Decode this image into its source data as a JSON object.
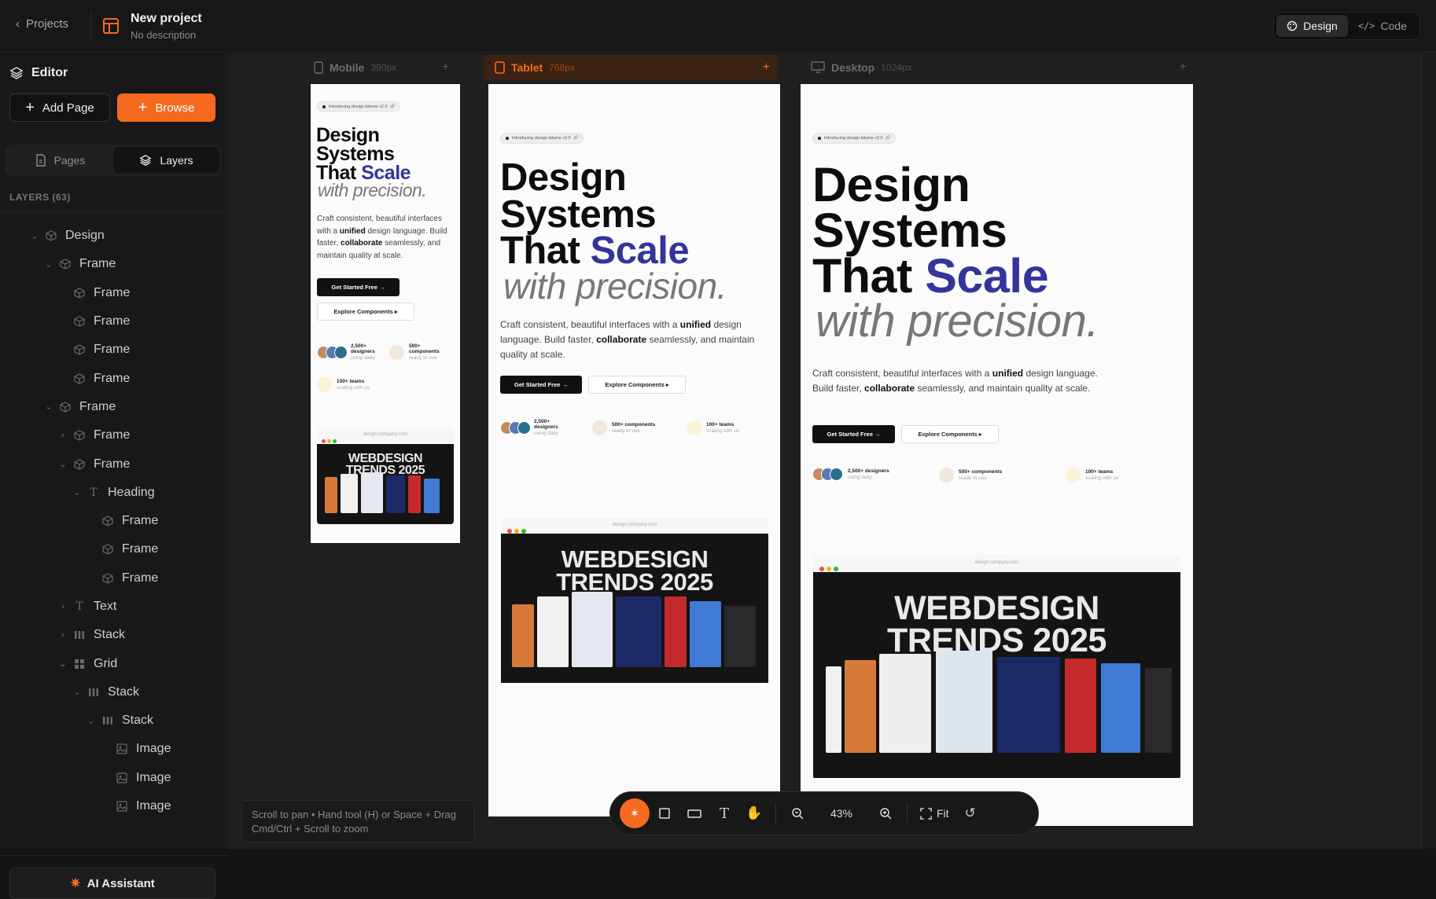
{
  "header": {
    "back_label": "Projects",
    "project_title": "New project",
    "project_desc": "No description",
    "modes": [
      "Design",
      "Code"
    ]
  },
  "sidebar": {
    "title": "Editor",
    "add_page": "Add Page",
    "browse": "Browse",
    "tabs": [
      "Pages",
      "Layers"
    ],
    "layers_count": "LAYERS (63)",
    "ai_label": "AI Assistant",
    "layers": [
      {
        "label": "Design",
        "depth": 0,
        "chev": "open",
        "icon": "component-icon"
      },
      {
        "label": "Frame",
        "depth": 1,
        "chev": "open",
        "icon": "component-icon"
      },
      {
        "label": "Frame",
        "depth": 2,
        "chev": "",
        "icon": "component-icon"
      },
      {
        "label": "Frame",
        "depth": 2,
        "chev": "",
        "icon": "component-icon"
      },
      {
        "label": "Frame",
        "depth": 2,
        "chev": "",
        "icon": "component-icon"
      },
      {
        "label": "Frame",
        "depth": 2,
        "chev": "",
        "icon": "component-icon"
      },
      {
        "label": "Frame",
        "depth": 1,
        "chev": "open",
        "icon": "component-icon"
      },
      {
        "label": "Frame",
        "depth": 2,
        "chev": "closed",
        "icon": "component-icon"
      },
      {
        "label": "Frame",
        "depth": 2,
        "chev": "open",
        "icon": "component-icon"
      },
      {
        "label": "Heading",
        "depth": 3,
        "chev": "open",
        "icon": "text-icon"
      },
      {
        "label": "Frame",
        "depth": 4,
        "chev": "",
        "icon": "component-icon"
      },
      {
        "label": "Frame",
        "depth": 4,
        "chev": "",
        "icon": "component-icon"
      },
      {
        "label": "Frame",
        "depth": 4,
        "chev": "",
        "icon": "component-icon"
      },
      {
        "label": "Text",
        "depth": 2,
        "chev": "closed",
        "icon": "text-icon"
      },
      {
        "label": "Stack",
        "depth": 2,
        "chev": "closed",
        "icon": "stack-icon"
      },
      {
        "label": "Grid",
        "depth": 2,
        "chev": "open",
        "icon": "grid-icon"
      },
      {
        "label": "Stack",
        "depth": 3,
        "chev": "open",
        "icon": "stack-icon"
      },
      {
        "label": "Stack",
        "depth": 4,
        "chev": "open",
        "icon": "stack-icon"
      },
      {
        "label": "Image",
        "depth": 5,
        "chev": "",
        "icon": "image-icon"
      },
      {
        "label": "Image",
        "depth": 5,
        "chev": "",
        "icon": "image-icon"
      },
      {
        "label": "Image",
        "depth": 5,
        "chev": "",
        "icon": "image-icon"
      }
    ]
  },
  "devices": {
    "mobile": {
      "name": "Mobile",
      "px": "390px"
    },
    "tablet": {
      "name": "Tablet",
      "px": "768px"
    },
    "desktop": {
      "name": "Desktop",
      "px": "1024px"
    }
  },
  "preview": {
    "badge": "Introducing design tokens v2.0",
    "line1": "Design",
    "line2": "Systems",
    "line3a": "That ",
    "line3b": "Scale",
    "line4": "with precision.",
    "p1": "Craft consistent, beautiful interfaces with a ",
    "p_b1": "unified",
    "p2": " design language. Build faster, ",
    "p_b2": "collaborate",
    "p3": " seamlessly, and maintain quality at scale.",
    "cta_primary": "Get Started Free →",
    "cta_secondary": "Explore Components ▸",
    "stat1_title": "2,500+ designers",
    "stat1_sub": "using daily",
    "stat2_title": "500+ components",
    "stat2_sub": "ready to use",
    "stat3_title": "100+ teams",
    "stat3_sub": "scaling with us",
    "stat1_title_m": "2,500+",
    "stat1_title_m2": "designers",
    "stat2_title_m": "500+",
    "stat2_title_m2": "components",
    "url": "design.company.com",
    "hero_l1": "WEBDESIGN",
    "hero_l2": "TRENDS 2025"
  },
  "canvas": {
    "hint_line1": "Scroll to pan • Hand tool (H) or Space + Drag",
    "hint_line2": "Cmd/Ctrl + Scroll to zoom",
    "zoom": "43%",
    "fit": "Fit"
  },
  "colors": {
    "accent": "#f56a1f",
    "scale_blue": "#34359a"
  }
}
